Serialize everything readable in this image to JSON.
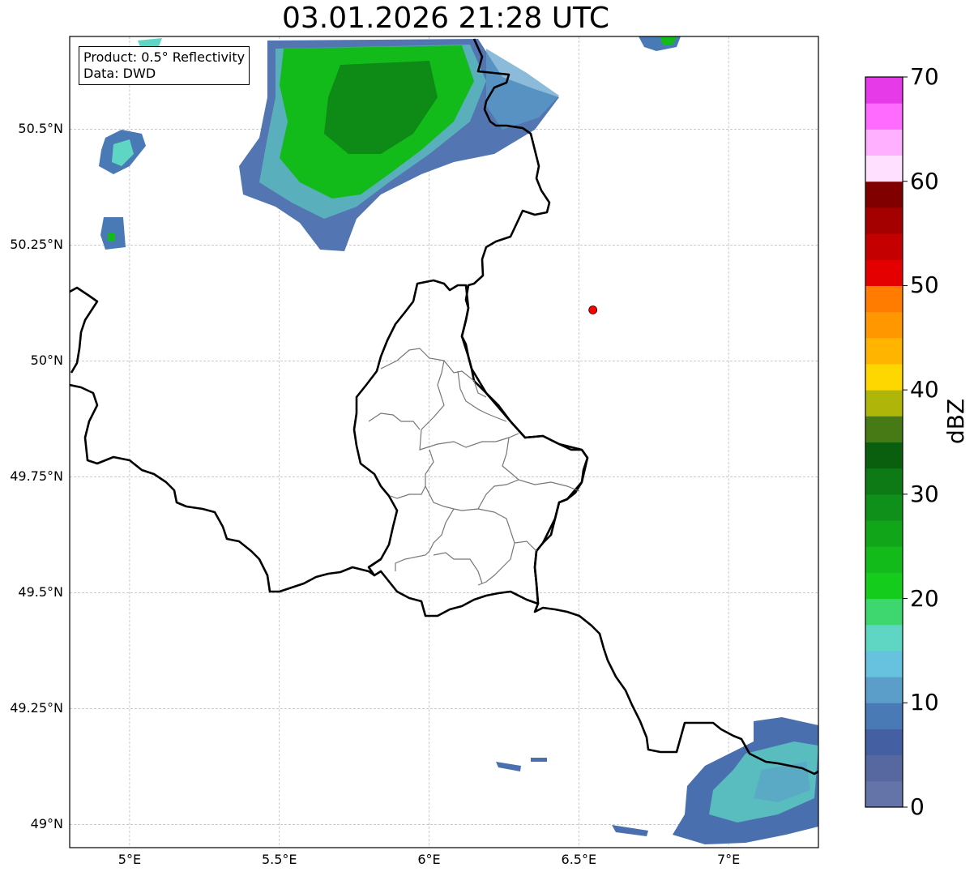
{
  "title": "03.01.2026 21:28 UTC",
  "info_box": {
    "product": "Product: 0.5° Reflectivity",
    "data_source": "Data: DWD"
  },
  "axes": {
    "lat_labels": [
      "50.5°N",
      "50.25°N",
      "50°N",
      "49.75°N",
      "49.5°N",
      "49.25°N",
      "49°N"
    ],
    "lat_values": [
      50.5,
      50.25,
      50.0,
      49.75,
      49.5,
      49.25,
      49.0
    ],
    "lon_labels": [
      "5°E",
      "5.5°E",
      "6°E",
      "6.5°E",
      "7°E"
    ],
    "lon_values": [
      5.0,
      5.5,
      6.0,
      6.5,
      7.0
    ],
    "lon_range": [
      4.8,
      7.3
    ],
    "lat_range": [
      48.95,
      50.7
    ],
    "grid": true
  },
  "radar_site": {
    "lon": 6.547,
    "lat": 50.11,
    "color": "#ff0000"
  },
  "colorbar": {
    "label": "dBZ",
    "min": 0,
    "max": 70,
    "step": 2.5,
    "tick_labels": [
      "0",
      "10",
      "20",
      "30",
      "40",
      "50",
      "60",
      "70"
    ],
    "tick_values": [
      0,
      10,
      20,
      30,
      40,
      50,
      60,
      70
    ],
    "colors": [
      "#6474a8",
      "#56689f",
      "#4460a3",
      "#4a7ab5",
      "#5b9ec9",
      "#66c2de",
      "#5fd6c4",
      "#3ed66e",
      "#14cc1c",
      "#13bb1a",
      "#11a619",
      "#0f901a",
      "#0d7a16",
      "#095f0e",
      "#477914",
      "#b0b50a",
      "#ffd700",
      "#ffb400",
      "#ff9800",
      "#ff7c00",
      "#e50000",
      "#c50000",
      "#a40000",
      "#800000",
      "#ffe0ff",
      "#ffb0ff",
      "#ff6aff",
      "#e63ae8"
    ]
  }
}
